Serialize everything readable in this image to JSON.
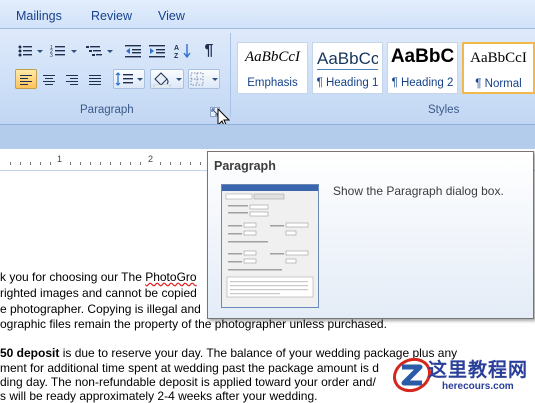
{
  "tabs": {
    "mailings": "Mailings",
    "review": "Review",
    "view": "View"
  },
  "ribbon": {
    "paragraph_label": "Paragraph",
    "styles_label": "Styles",
    "sort_label": "A Z",
    "pilcrow": "¶",
    "styles": [
      {
        "sample": "AaBbCcI",
        "name": "Emphasis"
      },
      {
        "sample": "AaBbCc",
        "name": "¶ Heading 1"
      },
      {
        "sample": "AaBbC",
        "name": "¶ Heading 2"
      },
      {
        "sample": "AaBbCcI",
        "name": "¶ Normal"
      }
    ],
    "colors": {
      "highlight": "#ffc35a",
      "border": "#9ebbe2"
    }
  },
  "ruler": {
    "n1": "1",
    "n2": "2"
  },
  "tooltip": {
    "title": "Paragraph",
    "description": "Show the Paragraph dialog box."
  },
  "document": {
    "line1_prefix": "k you for choosing our The ",
    "line1_link": "PhotoGro",
    "line2": "righted images and cannot be copied",
    "line3": "e photographer. Copying is illegal and",
    "line4": "ographic files remain the property of the photographer unless purchased.",
    "line5_bold": "50 deposit",
    "line5_rest": " is due to reserve your day. The balance of your wedding package plus any",
    "line6": "ment for additional time spent at wedding past the  package amount is d",
    "line7": "ding day. The non-refundable deposit is applied toward your order and/",
    "line8": "s will be ready approximately 2-4 weeks after your wedding."
  },
  "watermark": {
    "text": "这里教程网",
    "url": "herecours.com"
  }
}
